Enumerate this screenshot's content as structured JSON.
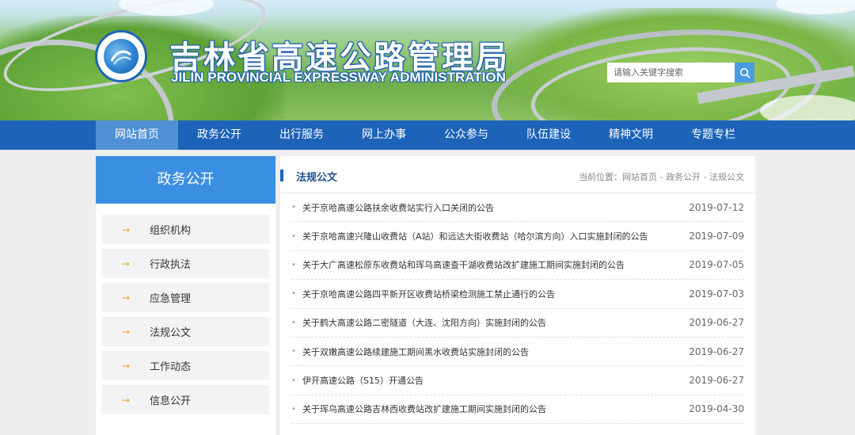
{
  "header": {
    "logo_text": "吉林省高速公路管理局",
    "title_cn": "吉林省高速公路管理局",
    "title_en": "JILIN PROVINCIAL EXPRESSWAY ADMINISTRATION",
    "search_placeholder": "请输入关键字搜索",
    "search_icon": "search-icon"
  },
  "nav": {
    "items": [
      "网站首页",
      "政务公开",
      "出行服务",
      "网上办事",
      "公众参与",
      "队伍建设",
      "精神文明",
      "专题专栏"
    ],
    "active_index": 0
  },
  "sidebar": {
    "title": "政务公开",
    "arrow": "→",
    "items": [
      "组织机构",
      "行政执法",
      "应急管理",
      "法规公文",
      "工作动态",
      "信息公开"
    ]
  },
  "main": {
    "title": "法规公文",
    "breadcrumb": "当前位置：网站首页 - 政务公开 - 法规公文",
    "bullet": "•",
    "articles": [
      {
        "title": "关于京哈高速公路扶余收费站实行入口关闭的公告",
        "date": "2019-07-12"
      },
      {
        "title": "关于京哈高速兴隆山收费站（A站）和远达大街收费站（哈尔滨方向）入口实施封闭的公告",
        "date": "2019-07-09"
      },
      {
        "title": "关于大广高速松原东收费站和珲乌高速查干湖收费站改扩建施工期间实施封闭的公告",
        "date": "2019-07-05"
      },
      {
        "title": "关于京哈高速公路四平新开区收费站桥梁检测施工禁止通行的公告",
        "date": "2019-07-03"
      },
      {
        "title": "关于鹤大高速公路二密隧道（大连、沈阳方向）实施封闭的公告",
        "date": "2019-06-27"
      },
      {
        "title": "关于双嫩高速公路续建施工期间黑水收费站实施封闭的公告",
        "date": "2019-06-27"
      },
      {
        "title": "伊开高速公路（S15）开通公告",
        "date": "2019-06-27"
      },
      {
        "title": "关于珲乌高速公路吉林西收费站改扩建施工期间实施封闭的公告",
        "date": "2019-04-30"
      }
    ]
  },
  "colors": {
    "nav_bg": "#1d63b8",
    "nav_active": "#5090d4",
    "sidebar_head": "#3b8fe3",
    "arrow": "#f0a234"
  }
}
